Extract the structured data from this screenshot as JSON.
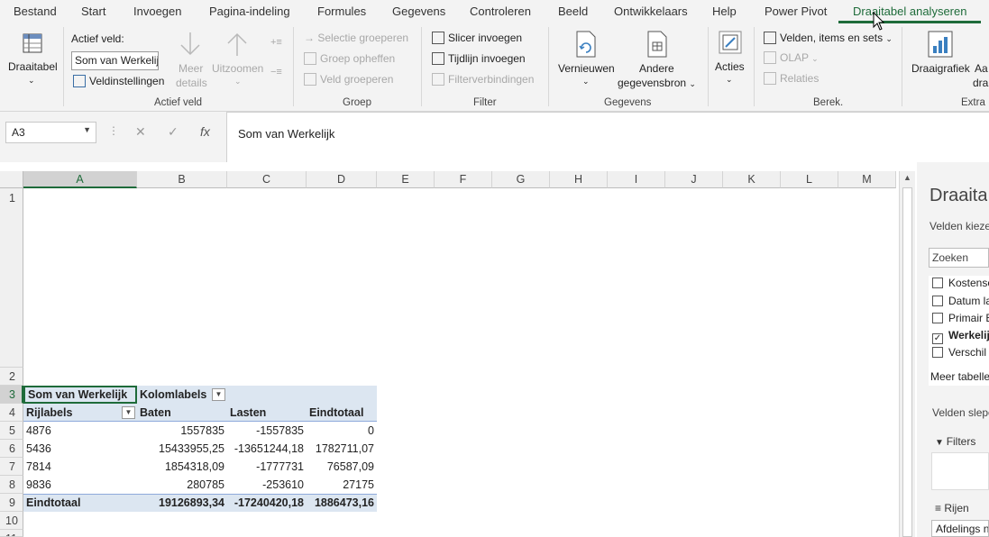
{
  "tabs": [
    "Bestand",
    "Start",
    "Invoegen",
    "Pagina-indeling",
    "Formules",
    "Gegevens",
    "Controleren",
    "Beeld",
    "Ontwikkelaars",
    "Help",
    "Power Pivot",
    "Draaitabel analyseren"
  ],
  "ribbon": {
    "draaitabel": "Draaitabel",
    "actief_veld_label": "Actief veld:",
    "actief_veld_value": "Som van Werkelij",
    "veldinstellingen": "Veldinstellingen",
    "meer_details_1": "Meer",
    "meer_details_2": "details",
    "uitzoomen": "Uitzoomen",
    "selectie_groeperen": "Selectie groeperen",
    "groep_opheffen": "Groep opheffen",
    "veld_groeperen": "Veld groeperen",
    "slicer_invoegen": "Slicer invoegen",
    "tijdlijn_invoegen": "Tijdlijn invoegen",
    "filterverbindingen": "Filterverbindingen",
    "vernieuwen": "Vernieuwen",
    "andere_1": "Andere",
    "andere_2": "gegevensbron",
    "acties": "Acties",
    "velden_items": "Velden, items en sets",
    "olap": "OLAP",
    "relaties": "Relaties",
    "draaigrafiek": "Draaigrafiek",
    "aa_1": "Aa",
    "aa_2": "dra",
    "groups": {
      "actief_veld": "Actief veld",
      "groep": "Groep",
      "filter": "Filter",
      "gegevens": "Gegevens",
      "berek": "Berek.",
      "extra": "Extra"
    }
  },
  "namebox": "A3",
  "formula": "Som van Werkelijk",
  "columns": [
    "A",
    "B",
    "C",
    "D",
    "E",
    "F",
    "G",
    "H",
    "I",
    "J",
    "K",
    "L",
    "M"
  ],
  "rows": [
    "1",
    "2",
    "3",
    "4",
    "5",
    "6",
    "7",
    "8",
    "9",
    "10",
    "11"
  ],
  "pivot": {
    "header": "Som van Werkelijk",
    "kolomlabels": "Kolomlabels",
    "rijlabels": "Rijlabels",
    "col_headers": [
      "Baten",
      "Lasten",
      "Eindtotaal"
    ],
    "data": [
      {
        "label": "4876",
        "baten": "1557835",
        "lasten": "-1557835",
        "totaal": "0"
      },
      {
        "label": "5436",
        "baten": "15433955,25",
        "lasten": "-13651244,18",
        "totaal": "1782711,07"
      },
      {
        "label": "7814",
        "baten": "1854318,09",
        "lasten": "-1777731",
        "totaal": "76587,09"
      },
      {
        "label": "9836",
        "baten": "280785",
        "lasten": "-253610",
        "totaal": "27175"
      }
    ],
    "total": {
      "label": "Eindtotaal",
      "baten": "19126893,34",
      "lasten": "-17240420,18",
      "totaal": "1886473,16"
    }
  },
  "pane": {
    "title": "Draaita",
    "velden_kiezen": "Velden kieze",
    "zoeken": "Zoeken",
    "fields": [
      {
        "name": "Kostensc",
        "checked": false
      },
      {
        "name": "Datum la",
        "checked": false
      },
      {
        "name": "Primair E",
        "checked": false
      },
      {
        "name": "Werkelij",
        "checked": true
      },
      {
        "name": "Verschil",
        "checked": false
      }
    ],
    "meer_tabellen": "Meer tabelle",
    "velden_slepen": "Velden slepe",
    "filters": "Filters",
    "rijen": "Rijen",
    "rij_item": "Afdelings n"
  },
  "colors": {
    "accent": "#1e6b3a",
    "pivot_header": "#dce6f1"
  }
}
